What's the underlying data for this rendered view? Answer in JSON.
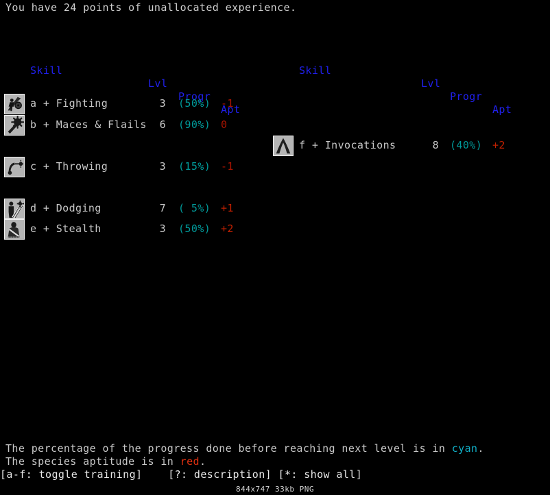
{
  "status_line": "You have 24 points of unallocated experience.",
  "headers": {
    "skill": "Skill",
    "lvl": "Lvl",
    "progr": "Progr",
    "apt": "Apt"
  },
  "colors": {
    "header_blue": "#2020ee",
    "progress_cyan": "#009a9a",
    "aptitude_red": "#c22000",
    "text_gray": "#c8c8c8",
    "background": "#000000",
    "icon_background": "#b9b9b9"
  },
  "left_column": {
    "rows": [
      {
        "slot": 0,
        "icon": "fighting-icon",
        "name": "a + Fighting",
        "lvl": "3",
        "progr": "(50%)",
        "apt": "-1"
      },
      {
        "slot": 1,
        "icon": "mace-icon",
        "name": "b + Maces & Flails",
        "lvl": "6",
        "progr": "(90%)",
        "apt": "0"
      },
      {
        "slot": 3,
        "icon": "throwing-icon",
        "name": "c + Throwing",
        "lvl": "3",
        "progr": "(15%)",
        "apt": "-1"
      },
      {
        "slot": 5,
        "icon": "dodging-icon",
        "name": "d + Dodging",
        "lvl": "7",
        "progr": "( 5%)",
        "apt": "+1"
      },
      {
        "slot": 6,
        "icon": "stealth-icon",
        "name": "e + Stealth",
        "lvl": "3",
        "progr": "(50%)",
        "apt": "+2"
      }
    ]
  },
  "right_column": {
    "rows": [
      {
        "slot": 2,
        "icon": "invocations-icon",
        "name": "f + Invocations",
        "lvl": "8",
        "progr": "(40%)",
        "apt": "+2"
      }
    ]
  },
  "legend": {
    "line1_pre": "The percentage of the progress done before reaching next level is in ",
    "line1_word": "cyan",
    "line1_post": ".",
    "line2_pre": "The species aptitude is in ",
    "line2_word": "red",
    "line2_post": "."
  },
  "keys_line": "[a-f: toggle training]    [?: description] [*: show all]",
  "caption": "844x747 33kb PNG"
}
